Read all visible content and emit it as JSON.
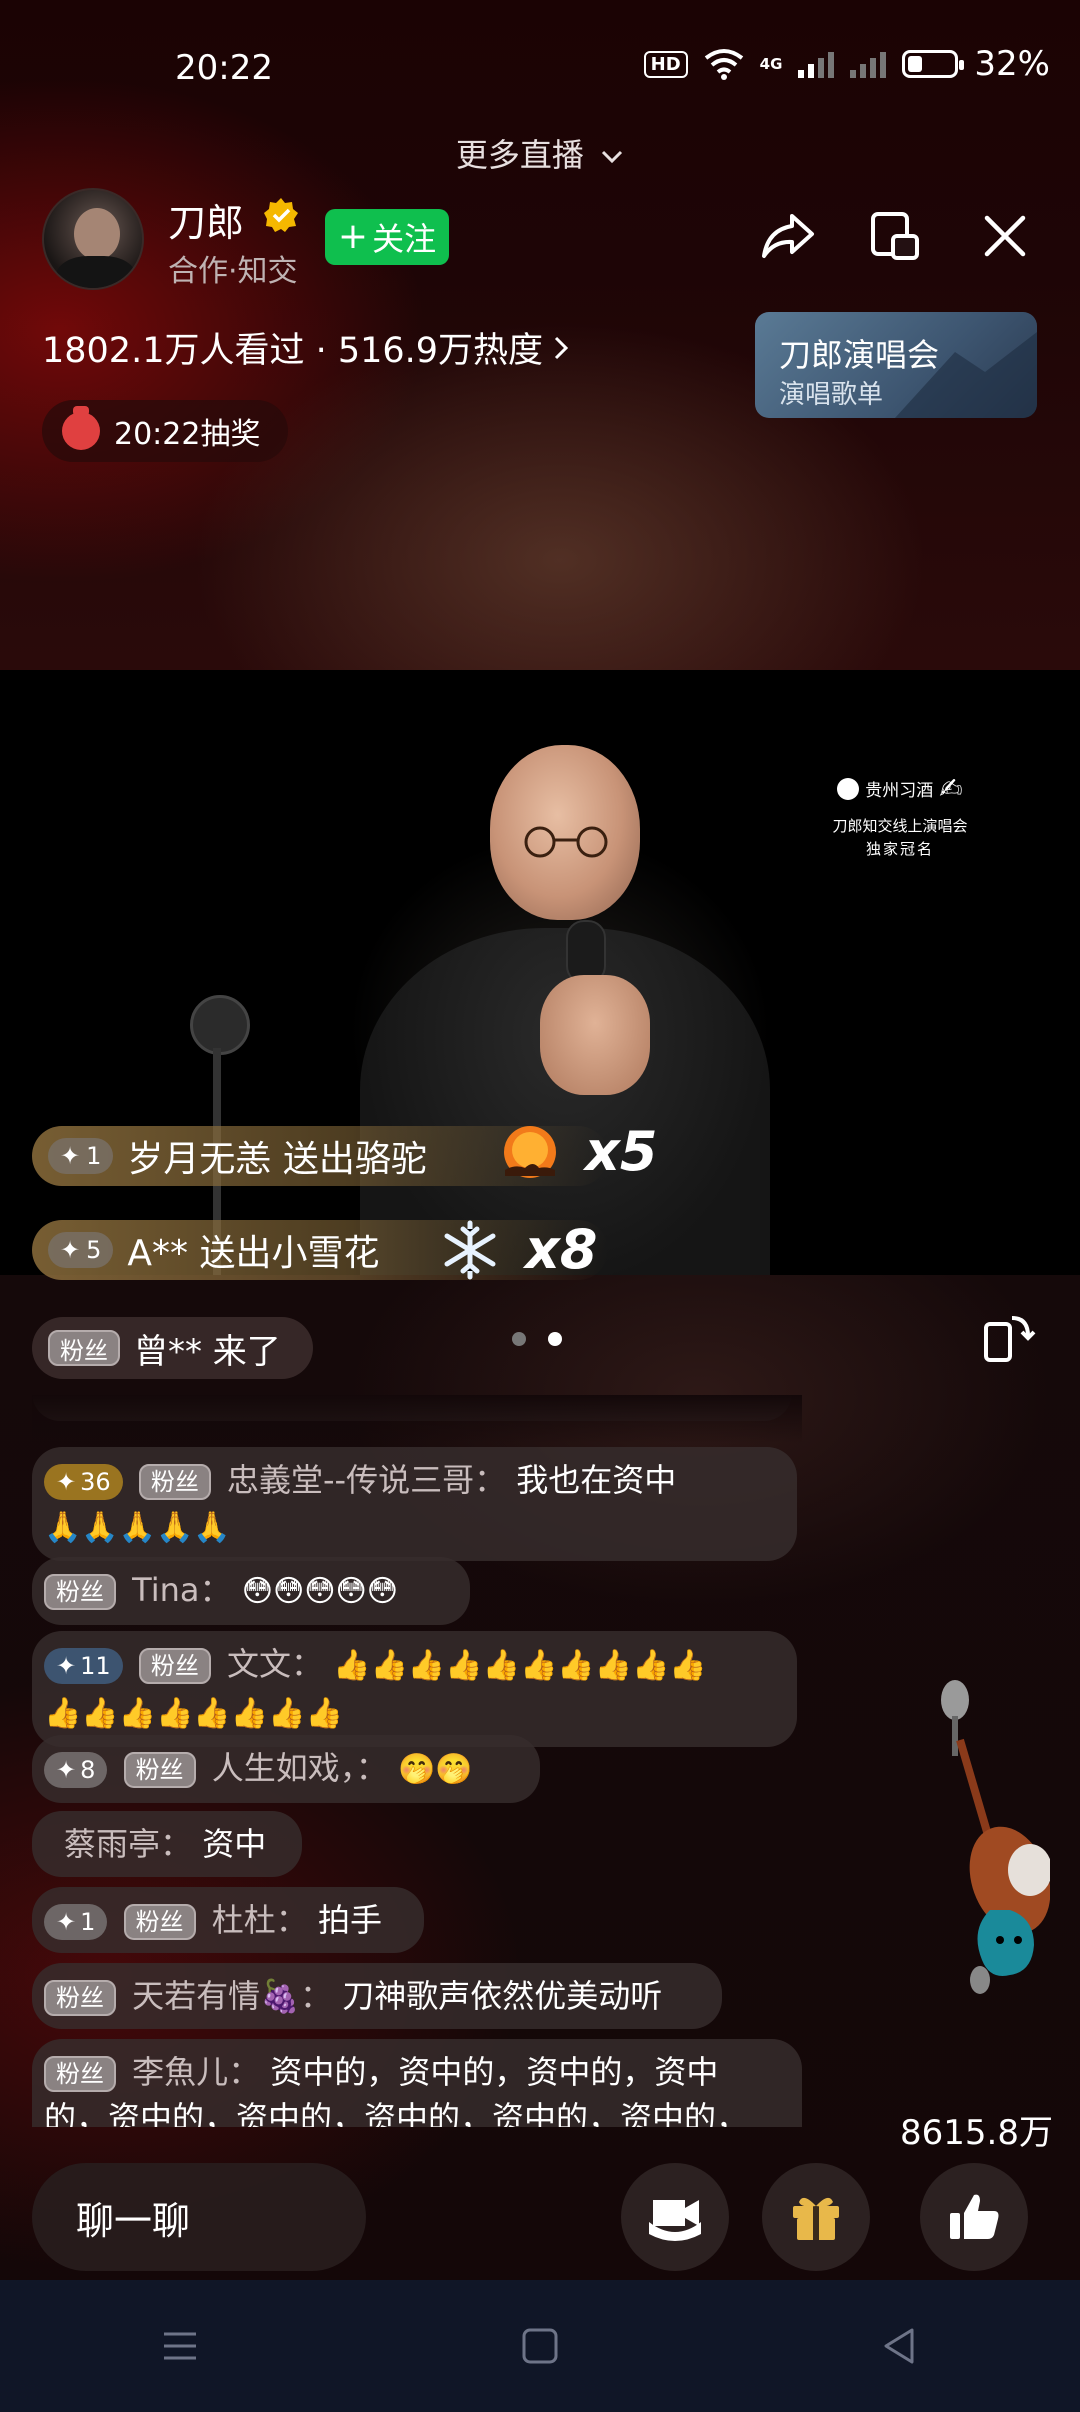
{
  "status_bar": {
    "time": "20:22",
    "hd": "HD",
    "network": "4G",
    "battery_text": "32%",
    "battery_level": 0.32
  },
  "header": {
    "more_live": "更多直播",
    "host_name": "刀郎",
    "host_sub": "合作·知交",
    "follow_label": "关注",
    "stats": "1802.1万人看过 · 516.9万热度",
    "lottery": "20:22抽奖",
    "concert_card": {
      "title": "刀郎演唱会",
      "subtitle": "演唱歌单"
    }
  },
  "video": {
    "sponsor": {
      "brand": "贵州习酒",
      "line1": "刀郎知交线上演唱会",
      "line2": "独家冠名"
    }
  },
  "gifts": [
    {
      "level": "1",
      "text": "岁月无恙 送出骆驼",
      "count": "x5",
      "icon": "camel-sunset-icon"
    },
    {
      "level": "5",
      "text": "A** 送出小雪花",
      "count": "x8",
      "icon": "snowflake-icon"
    }
  ],
  "enter_message": {
    "badge": "粉丝",
    "text": "曾** 来了"
  },
  "chat": [
    {
      "level": "36",
      "fan": "粉丝",
      "user": "忠義堂--传说三哥",
      "sep": "：",
      "message": "我也在资中",
      "line2": "🙏🙏🙏🙏🙏"
    },
    {
      "fan": "粉丝",
      "user": "Tina",
      "sep": "：",
      "message": "😳😳😳😳😳"
    },
    {
      "level": "11",
      "fan": "粉丝",
      "user": "文文",
      "sep": "：",
      "message": "👍👍👍👍👍👍👍👍👍👍",
      "line2": "👍👍👍👍👍👍👍👍"
    },
    {
      "level": "8",
      "fan": "粉丝",
      "user": "人生如戏，",
      "sep": "：",
      "message": "🤭🤭"
    },
    {
      "user": "蔡雨亭",
      "sep": "：",
      "message": "资中"
    },
    {
      "level": "1",
      "fan": "粉丝",
      "user": "杜杜",
      "sep": "：",
      "message": "拍手"
    },
    {
      "fan": "粉丝",
      "user": "天若有情🍇",
      "sep": "：",
      "message": "刀神歌声依然优美动听"
    },
    {
      "fan": "粉丝",
      "user": "李魚儿",
      "sep": "：",
      "message": "资中的，资中的，资中的，资中",
      "line2": "的，资中的，资中的，资中的，资中的，资中的，"
    }
  ],
  "like_count": "8615.8万",
  "bottom": {
    "chat_placeholder": "聊一聊"
  },
  "colors": {
    "follow_green": "#0fbf4e",
    "gold_badge": "#9a7420",
    "nav_bg": "#101627"
  }
}
